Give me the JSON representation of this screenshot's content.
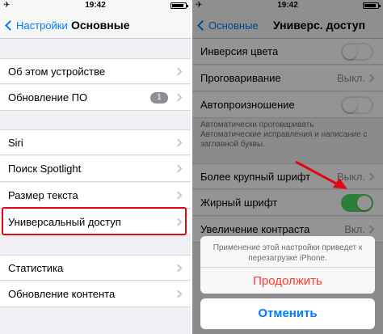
{
  "colors": {
    "accent": "#007aff",
    "highlight": "#e30613",
    "destructive": "#ff3b30",
    "toggle_on": "#4cd964"
  },
  "left": {
    "status": {
      "carrier_icon": "airplane-icon",
      "time": "19:42"
    },
    "nav": {
      "back_label": "Настройки",
      "title": "Основные"
    },
    "rows": [
      {
        "label": "Об этом устройстве"
      },
      {
        "label": "Обновление ПО",
        "badge": "1"
      },
      {
        "label": "Siri"
      },
      {
        "label": "Поиск Spotlight"
      },
      {
        "label": "Размер текста"
      },
      {
        "label": "Универсальный доступ"
      },
      {
        "label": "Статистика"
      },
      {
        "label": "Обновление контента"
      }
    ]
  },
  "right": {
    "status": {
      "carrier_icon": "airplane-icon",
      "time": "19:42"
    },
    "nav": {
      "back_label": "Основные",
      "title": "Универс. доступ"
    },
    "rows": [
      {
        "label": "Инверсия цвета",
        "toggle": false
      },
      {
        "label": "Проговаривание",
        "value": "Выкл."
      },
      {
        "label": "Автопроизношение",
        "toggle": false
      },
      {
        "label": "Более крупный шрифт",
        "value": "Выкл."
      },
      {
        "label": "Жирный шрифт",
        "toggle": true
      },
      {
        "label": "Увеличение контраста",
        "value": "Вкл."
      }
    ],
    "footnote": "Автоматические исправления и написание с заглавной буквы.",
    "footnote_first_line": "Автоматически проговаривать",
    "alert": {
      "message": "Применение этой настройки приведет к перезагрузке iPhone.",
      "confirm_label": "Продолжить",
      "cancel_label": "Отменить"
    }
  }
}
